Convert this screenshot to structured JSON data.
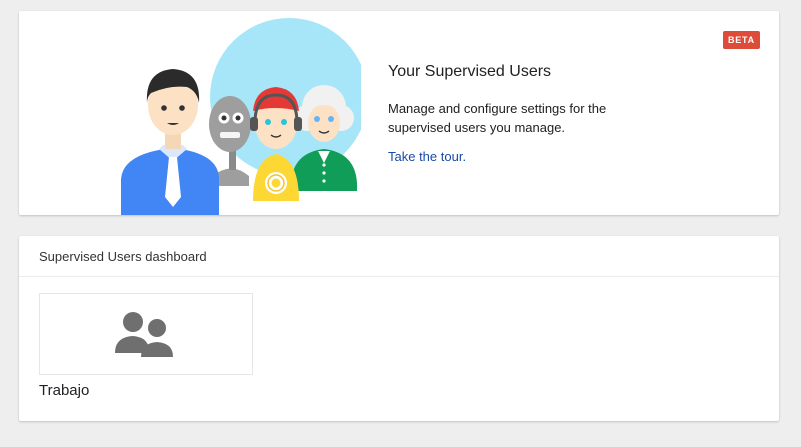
{
  "hero": {
    "title": "Your Supervised Users",
    "description": "Manage and configure settings for the supervised users you manage.",
    "link_label": "Take the tour.",
    "badge": "BETA"
  },
  "dashboard": {
    "title": "Supervised Users dashboard",
    "users": [
      {
        "name": "Trabajo",
        "icon": "people-icon"
      }
    ]
  },
  "colors": {
    "badge": "#dd4b39",
    "link": "#1a4aa8",
    "page_background": "#eeeeee",
    "illustration_circle": "#a7e6f8"
  }
}
